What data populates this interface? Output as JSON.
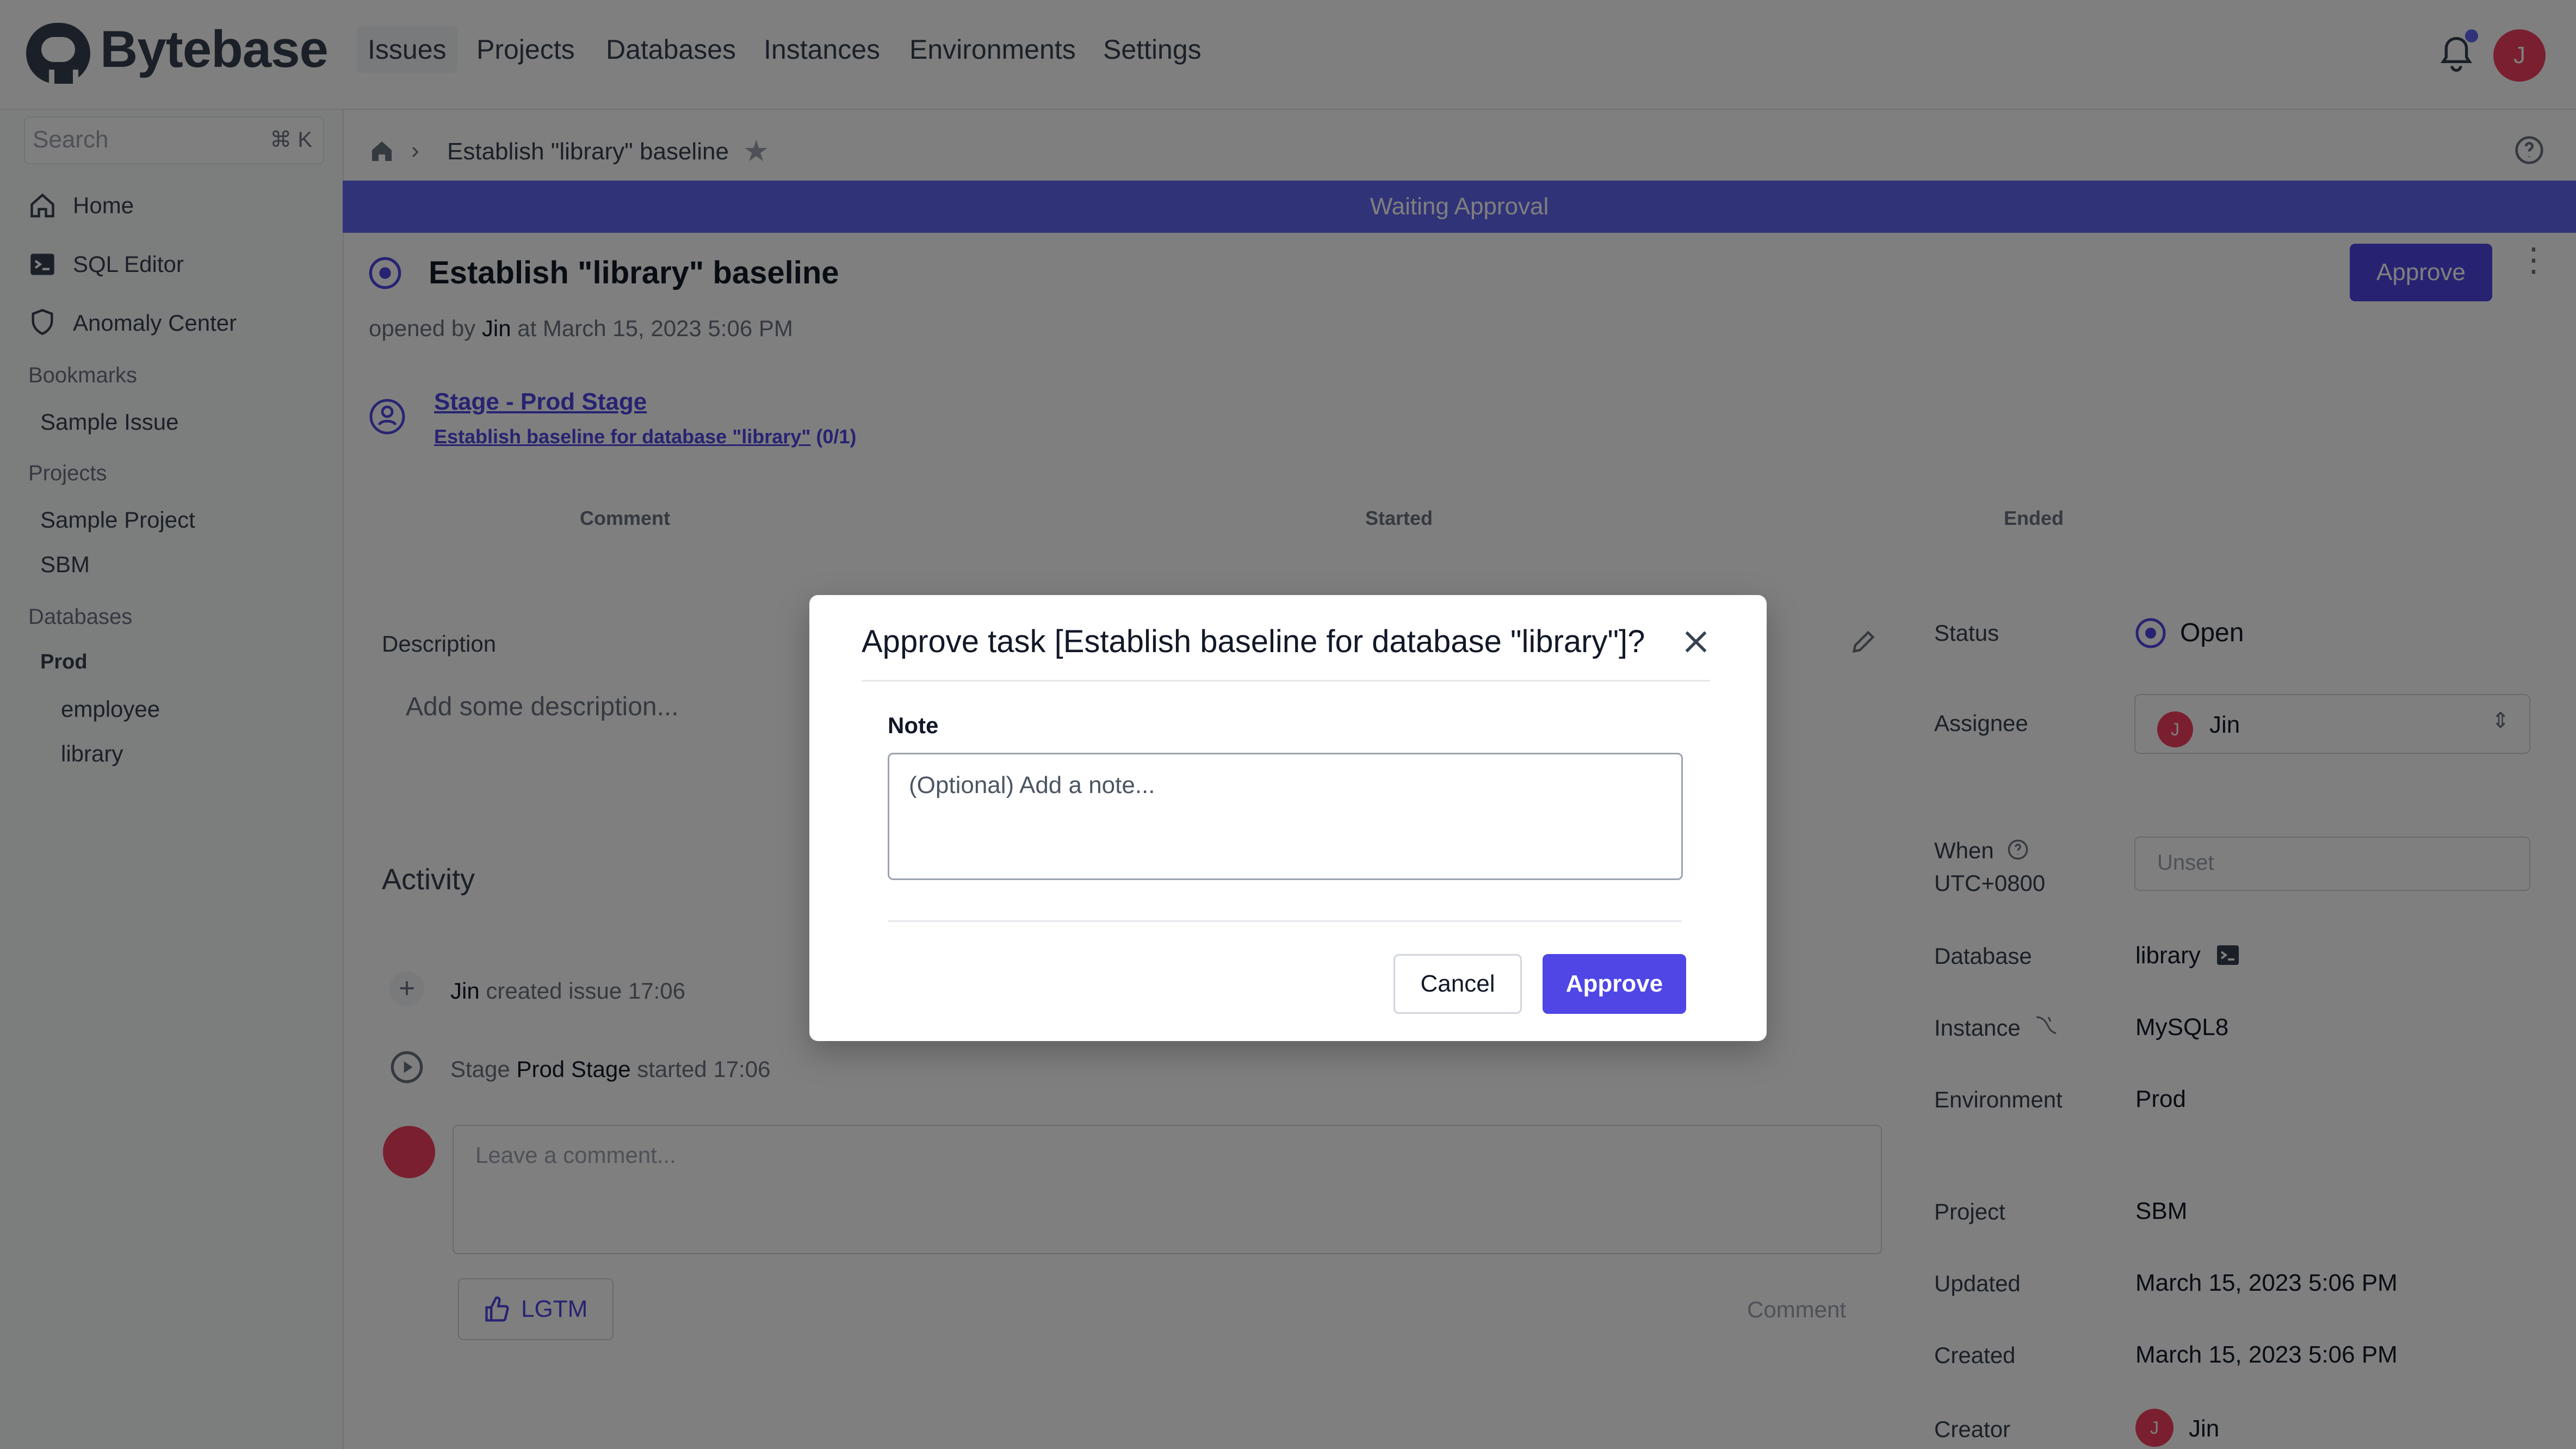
{
  "app": {
    "name": "Bytebase"
  },
  "header": {
    "nav": [
      "Issues",
      "Projects",
      "Databases",
      "Instances",
      "Environments",
      "Settings"
    ],
    "user_initial": "J"
  },
  "sidebar": {
    "search_placeholder": "Search",
    "search_shortcut": "⌘ K",
    "items": [
      {
        "label": "Home",
        "icon": "home-icon"
      },
      {
        "label": "SQL Editor",
        "icon": "terminal-icon"
      },
      {
        "label": "Anomaly Center",
        "icon": "shield-icon"
      }
    ],
    "bookmarks_header": "Bookmarks",
    "bookmarks": [
      "Sample Issue"
    ],
    "projects_header": "Projects",
    "projects": [
      "Sample Project",
      "SBM"
    ],
    "databases_header": "Databases",
    "env_name": "Prod",
    "databases": [
      "employee",
      "library"
    ]
  },
  "breadcrumb": {
    "current": "Establish \"library\" baseline"
  },
  "banner": {
    "text": "Waiting Approval"
  },
  "issue": {
    "title": "Establish \"library\" baseline",
    "approve_label": "Approve",
    "meta_prefix": "opened by",
    "meta_author": "Jin",
    "meta_suffix": "at March 15, 2023 5:06 PM",
    "stage_link": "Stage - Prod Stage",
    "task_link": "Establish baseline for database \"library\"",
    "task_count": "(0/1)",
    "table_headers": [
      "Comment",
      "Started",
      "Ended"
    ],
    "description_label": "Description",
    "description_placeholder": "Add some description...",
    "activity_title": "Activity",
    "activities": [
      {
        "actor": "Jin",
        "action": "created issue",
        "time": "17:06"
      },
      {
        "prefix": "Stage",
        "actor": "Prod Stage",
        "action": "started",
        "time": "17:06"
      }
    ],
    "comment_placeholder": "Leave a comment...",
    "lgtm_label": "LGTM",
    "comment_button": "Comment"
  },
  "details": {
    "status_label": "Status",
    "status_value": "Open",
    "assignee_label": "Assignee",
    "assignee_value": "Jin",
    "assignee_initial": "J",
    "when_label": "When",
    "when_tz": "UTC+0800",
    "when_placeholder": "Unset",
    "database_label": "Database",
    "database_value": "library",
    "instance_label": "Instance",
    "instance_value": "MySQL8",
    "environment_label": "Environment",
    "environment_value": "Prod",
    "project_label": "Project",
    "project_value": "SBM",
    "updated_label": "Updated",
    "updated_value": "March 15, 2023 5:06 PM",
    "created_label": "Created",
    "created_value": "March 15, 2023 5:06 PM",
    "creator_label": "Creator",
    "creator_value": "Jin",
    "creator_initial": "J"
  },
  "modal": {
    "title": "Approve task [Establish baseline for database \"library\"]?",
    "note_label": "Note",
    "note_placeholder": "(Optional) Add a note...",
    "cancel_label": "Cancel",
    "approve_label": "Approve"
  },
  "colors": {
    "accent": "#4f46e5",
    "banner": "#6366f1",
    "avatar": "#f43f5e",
    "overlay": "rgba(0,0,0,0.5)"
  }
}
